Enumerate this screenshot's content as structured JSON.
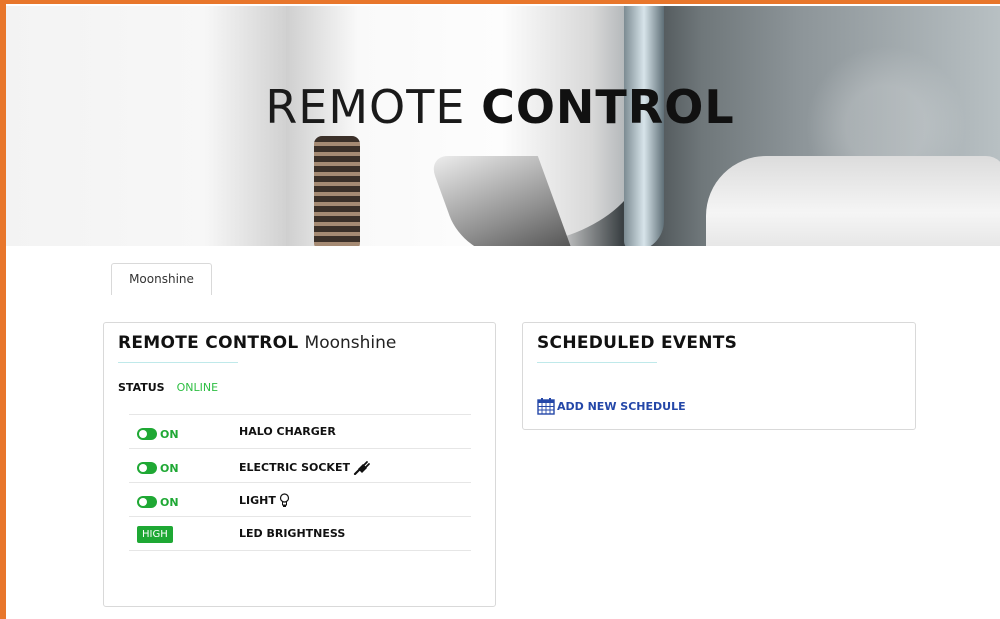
{
  "hero": {
    "title_light": "REMOTE",
    "title_bold": "CONTROL"
  },
  "tabs": [
    {
      "label": "Moonshine"
    }
  ],
  "remote_panel": {
    "title": "REMOTE CONTROL",
    "device": "Moonshine",
    "status_label": "STATUS",
    "status_value": "ONLINE",
    "rows": [
      {
        "state": "ON",
        "label": "HALO CHARGER",
        "icon": "none"
      },
      {
        "state": "ON",
        "label": "ELECTRIC SOCKET",
        "icon": "plug-icon"
      },
      {
        "state": "ON",
        "label": "LIGHT",
        "icon": "lightbulb-icon"
      },
      {
        "state": "HIGH",
        "label": "LED BRIGHTNESS",
        "icon": "none"
      }
    ]
  },
  "schedule_panel": {
    "title": "SCHEDULED EVENTS",
    "add_label": "ADD NEW SCHEDULE",
    "icon": "calendar-icon"
  },
  "colors": {
    "frame": "#e8762b",
    "online": "#2fbf44",
    "toggle": "#1fa834",
    "link": "#2447a8"
  }
}
